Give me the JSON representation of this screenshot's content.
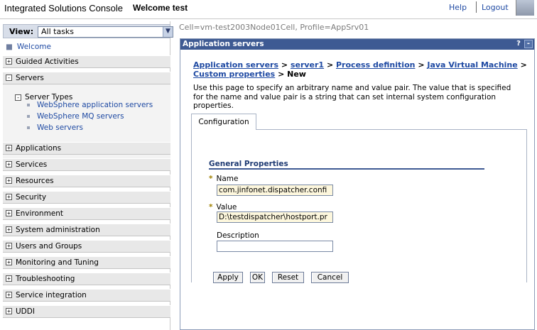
{
  "header": {
    "app_title": "Integrated Solutions Console",
    "welcome": "Welcome test",
    "help": "Help",
    "logout": "Logout"
  },
  "nav": {
    "view_label": "View:",
    "view_value": "All tasks",
    "welcome": "Welcome",
    "items": [
      {
        "label": "Guided Activities",
        "state": "+"
      },
      {
        "label": "Servers",
        "state": "-"
      },
      {
        "label": "Applications",
        "state": "+"
      },
      {
        "label": "Services",
        "state": "+"
      },
      {
        "label": "Resources",
        "state": "+"
      },
      {
        "label": "Security",
        "state": "+"
      },
      {
        "label": "Environment",
        "state": "+"
      },
      {
        "label": "System administration",
        "state": "+"
      },
      {
        "label": "Users and Groups",
        "state": "+"
      },
      {
        "label": "Monitoring and Tuning",
        "state": "+"
      },
      {
        "label": "Troubleshooting",
        "state": "+"
      },
      {
        "label": "Service integration",
        "state": "+"
      },
      {
        "label": "UDDI",
        "state": "+"
      }
    ],
    "server_types": {
      "label": "Server Types",
      "state": "-",
      "children": [
        "WebSphere application servers",
        "WebSphere MQ servers",
        "Web servers"
      ]
    }
  },
  "main": {
    "cell_info": "Cell=vm-test2003Node01Cell, Profile=AppSrv01",
    "portlet_title": "Application servers",
    "help_btn": "?",
    "min_btn": "-",
    "breadcrumb": {
      "links": [
        "Application servers",
        "server1",
        "Process definition",
        "Java Virtual Machine",
        "Custom properties"
      ],
      "sep": ">",
      "current": "New"
    },
    "description": "Use this page to specify an arbitrary name and value pair. The value that is specified for the name and value pair is a string that can set internal system configuration properties.",
    "tab": "Configuration",
    "general_properties": "General Properties",
    "required_marker": "*",
    "fields": {
      "name_label": "Name",
      "name_value": "com.jinfonet.dispatcher.confi",
      "value_label": "Value",
      "value_value": "D:\\testdispatcher\\hostport.pr",
      "description_label": "Description",
      "description_value": ""
    },
    "buttons": {
      "apply": "Apply",
      "ok": "OK",
      "reset": "Reset",
      "cancel": "Cancel"
    }
  }
}
